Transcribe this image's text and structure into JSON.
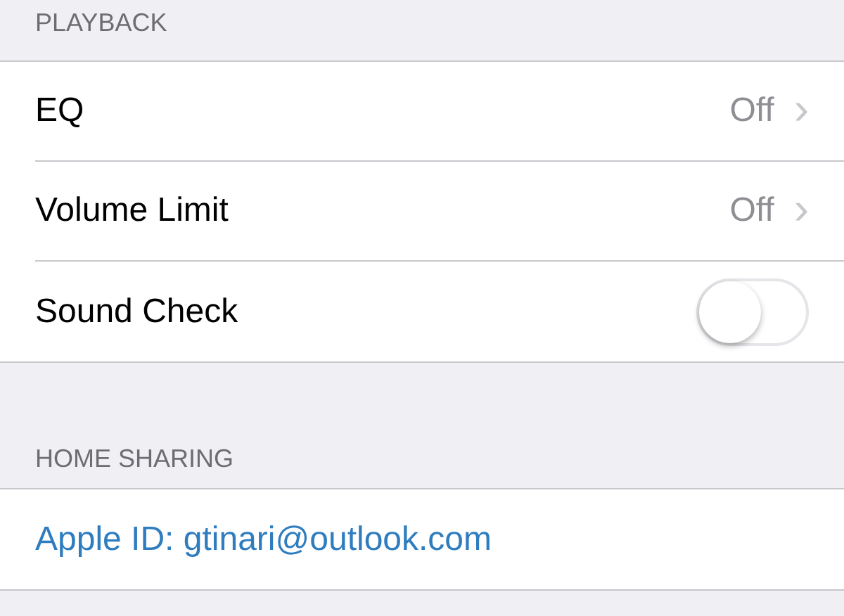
{
  "sections": [
    {
      "header": "PLAYBACK",
      "rows": [
        {
          "kind": "disclosure",
          "label": "EQ",
          "value": "Off",
          "chevron": "›"
        },
        {
          "kind": "disclosure",
          "label": "Volume Limit",
          "value": "Off",
          "chevron": "›"
        },
        {
          "kind": "toggle",
          "label": "Sound Check",
          "on": false
        }
      ]
    },
    {
      "header": "HOME SHARING",
      "rows": [
        {
          "kind": "link",
          "label": "Apple ID: gtinari@outlook.com"
        }
      ]
    }
  ]
}
